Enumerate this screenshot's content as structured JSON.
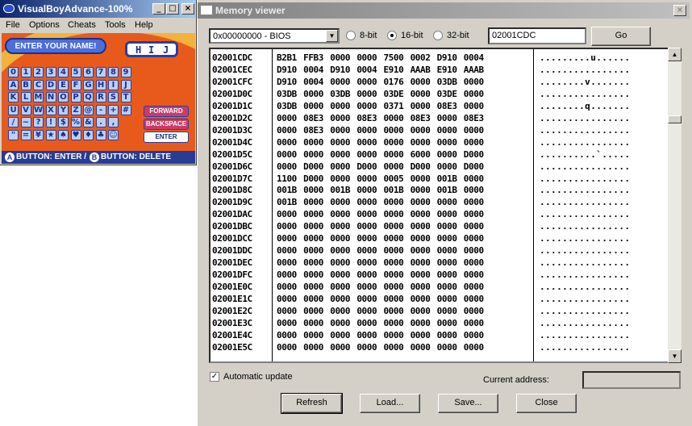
{
  "vba": {
    "title": "VisualBoyAdvance-100%",
    "menu": [
      "File",
      "Options",
      "Cheats",
      "Tools",
      "Help"
    ],
    "game": {
      "prompt": "ENTER YOUR NAME!",
      "name_chars": [
        "H",
        "I",
        "J"
      ],
      "keys": [
        [
          "0",
          "1",
          "2",
          "3",
          "4",
          "5",
          "6",
          "7",
          "8",
          "9"
        ],
        [
          "A",
          "B",
          "C",
          "D",
          "E",
          "F",
          "G",
          "H",
          "I",
          "J"
        ],
        [
          "K",
          "L",
          "M",
          "N",
          "O",
          "P",
          "Q",
          "R",
          "S",
          "T"
        ],
        [
          "U",
          "V",
          "W",
          "X",
          "Y",
          "Z",
          "@",
          "-",
          "+",
          "#"
        ],
        [
          "/",
          "~",
          "?",
          "!",
          "$",
          "%",
          "&",
          ".",
          ",",
          ""
        ],
        [
          "\"",
          "=",
          "¥",
          "★",
          "♠",
          "♥",
          "♦",
          "♣",
          "☺",
          ""
        ]
      ],
      "actions": [
        "FORWARD",
        "BACKSPACE",
        "ENTER"
      ],
      "hint_a": "A",
      "hint_a_text": "BUTTON: ENTER /",
      "hint_b": "B",
      "hint_b_text": "BUTTON: DELETE"
    }
  },
  "memory_viewer": {
    "title": "Memory viewer",
    "region": "0x00000000 - BIOS",
    "radios": [
      {
        "label": "8-bit",
        "selected": false
      },
      {
        "label": "16-bit",
        "selected": true
      },
      {
        "label": "32-bit",
        "selected": false
      }
    ],
    "address_input": "02001CDC",
    "go_label": "Go",
    "rows": [
      {
        "addr": "02001CDC",
        "hex": "B2B1 FFB3 0000 0000 7500 0002 D910 0004",
        "ascii": ".........u......"
      },
      {
        "addr": "02001CEC",
        "hex": "D910 0004 D910 0004 E910 AAAB E910 AAAB",
        "ascii": "................"
      },
      {
        "addr": "02001CFC",
        "hex": "D910 0004 0000 0000 0176 0000 03DB 0000",
        "ascii": "........v......."
      },
      {
        "addr": "02001D0C",
        "hex": "03DB 0000 03DB 0000 03DE 0000 03DE 0000",
        "ascii": "................"
      },
      {
        "addr": "02001D1C",
        "hex": "03DB 0000 0000 0000 0371 0000 08E3 0000",
        "ascii": "........q......."
      },
      {
        "addr": "02001D2C",
        "hex": "0000 08E3 0000 08E3 0000 08E3 0000 08E3",
        "ascii": "................"
      },
      {
        "addr": "02001D3C",
        "hex": "0000 08E3 0000 0000 0000 0000 0000 0000",
        "ascii": "................"
      },
      {
        "addr": "02001D4C",
        "hex": "0000 0000 0000 0000 0000 0000 0000 0000",
        "ascii": "................"
      },
      {
        "addr": "02001D5C",
        "hex": "0000 0000 0000 0000 0000 6000 0000 D000",
        "ascii": "..........`....."
      },
      {
        "addr": "02001D6C",
        "hex": "0000 D000 0000 D000 0000 D000 0000 D000",
        "ascii": "................"
      },
      {
        "addr": "02001D7C",
        "hex": "1100 D000 0000 0000 0005 0000 001B 0000",
        "ascii": "................"
      },
      {
        "addr": "02001D8C",
        "hex": "001B 0000 001B 0000 001B 0000 001B 0000",
        "ascii": "................"
      },
      {
        "addr": "02001D9C",
        "hex": "001B 0000 0000 0000 0000 0000 0000 0000",
        "ascii": "................"
      },
      {
        "addr": "02001DAC",
        "hex": "0000 0000 0000 0000 0000 0000 0000 0000",
        "ascii": "................"
      },
      {
        "addr": "02001DBC",
        "hex": "0000 0000 0000 0000 0000 0000 0000 0000",
        "ascii": "................"
      },
      {
        "addr": "02001DCC",
        "hex": "0000 0000 0000 0000 0000 0000 0000 0000",
        "ascii": "................"
      },
      {
        "addr": "02001DDC",
        "hex": "0000 0000 0000 0000 0000 0000 0000 0000",
        "ascii": "................"
      },
      {
        "addr": "02001DEC",
        "hex": "0000 0000 0000 0000 0000 0000 0000 0000",
        "ascii": "................"
      },
      {
        "addr": "02001DFC",
        "hex": "0000 0000 0000 0000 0000 0000 0000 0000",
        "ascii": "................"
      },
      {
        "addr": "02001E0C",
        "hex": "0000 0000 0000 0000 0000 0000 0000 0000",
        "ascii": "................"
      },
      {
        "addr": "02001E1C",
        "hex": "0000 0000 0000 0000 0000 0000 0000 0000",
        "ascii": "................"
      },
      {
        "addr": "02001E2C",
        "hex": "0000 0000 0000 0000 0000 0000 0000 0000",
        "ascii": "................"
      },
      {
        "addr": "02001E3C",
        "hex": "0000 0000 0000 0000 0000 0000 0000 0000",
        "ascii": "................"
      },
      {
        "addr": "02001E4C",
        "hex": "0000 0000 0000 0000 0000 0000 0000 0000",
        "ascii": "................"
      },
      {
        "addr": "02001E5C",
        "hex": "0000 0000 0000 0000 0000 0000 0000 0000",
        "ascii": "................"
      }
    ],
    "auto_update_label": "Automatic update",
    "auto_update_checked": true,
    "current_address_label": "Current address:",
    "current_address_value": "",
    "buttons": {
      "refresh": "Refresh",
      "load": "Load...",
      "save": "Save...",
      "close": "Close"
    }
  }
}
